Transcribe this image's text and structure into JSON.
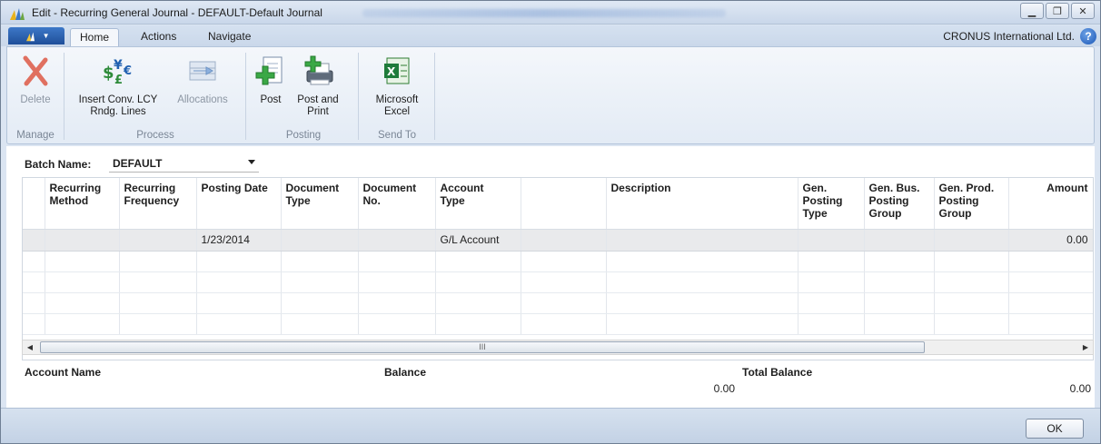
{
  "window": {
    "title": "Edit - Recurring General Journal - DEFAULT-Default Journal",
    "controls": [
      "minimize",
      "restore",
      "close"
    ]
  },
  "ribbon": {
    "tabs": [
      {
        "label": "Home",
        "active": true
      },
      {
        "label": "Actions",
        "active": false
      },
      {
        "label": "Navigate",
        "active": false
      }
    ],
    "company": "CRONUS International Ltd.",
    "groups": {
      "manage": "Manage",
      "process": "Process",
      "posting": "Posting",
      "send_to": "Send To"
    },
    "buttons": {
      "delete": "Delete",
      "insert_conv_l1": "Insert Conv. LCY",
      "insert_conv_l2": "Rndg. Lines",
      "allocations": "Allocations",
      "post": "Post",
      "post_print_l1": "Post and",
      "post_print_l2": "Print",
      "excel_l1": "Microsoft",
      "excel_l2": "Excel"
    }
  },
  "batch": {
    "label": "Batch Name:",
    "value": "DEFAULT"
  },
  "grid": {
    "columns": [
      {
        "l1": "Recurring",
        "l2": "Method",
        "l3": ""
      },
      {
        "l1": "Recurring",
        "l2": "Frequency",
        "l3": ""
      },
      {
        "l1": "Posting Date",
        "l2": "",
        "l3": ""
      },
      {
        "l1": "Document",
        "l2": "Type",
        "l3": ""
      },
      {
        "l1": "Document",
        "l2": "No.",
        "l3": ""
      },
      {
        "l1": "Account",
        "l2": "Type",
        "l3": ""
      },
      {
        "l1": "",
        "l2": "",
        "l3": ""
      },
      {
        "l1": "Description",
        "l2": "",
        "l3": ""
      },
      {
        "l1": "Gen.",
        "l2": "Posting",
        "l3": "Type"
      },
      {
        "l1": "Gen. Bus.",
        "l2": "Posting",
        "l3": "Group"
      },
      {
        "l1": "Gen. Prod.",
        "l2": "Posting",
        "l3": "Group"
      },
      {
        "l1": "Amount",
        "l2": "",
        "l3": ""
      }
    ],
    "rows": [
      [
        "",
        "",
        "1/23/2014",
        "",
        "",
        "G/L Account",
        "",
        "",
        "",
        "",
        "",
        "0.00"
      ]
    ],
    "scroll_thumb": "III"
  },
  "footer": {
    "account_name_label": "Account Name",
    "balance_label": "Balance",
    "total_balance_label": "Total Balance",
    "balance_value": "0.00",
    "total_balance_value": "0.00"
  },
  "ok_button": "OK"
}
